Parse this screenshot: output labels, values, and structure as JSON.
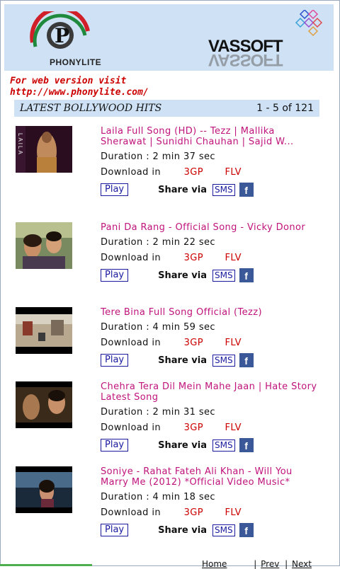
{
  "header": {
    "left_logo_text": "PHONYLITE",
    "right_logo_text": "VASSOFT"
  },
  "promo": {
    "line1": "For web version visit",
    "line2": "http://www.phonylite.com/"
  },
  "section": {
    "title": "LATEST BOLLYWOOD HITS",
    "range": "1 - 5 of 121"
  },
  "labels": {
    "download_in": "Download in",
    "format_3gp": "3GP",
    "format_flv": "FLV",
    "play": "Play",
    "share_via": "Share via",
    "sms": "SMS",
    "facebook_letter": "f"
  },
  "videos": [
    {
      "title": "Laila Full Song (HD) -- Tezz | Mallika Sherawat | Sunidhi Chauhan | Sajid W...",
      "duration": "Duration : 2 min 37 sec",
      "thumb_label": "LAILA"
    },
    {
      "title": "Pani Da Rang - Official Song - Vicky Donor",
      "duration": "Duration : 2 min 22 sec",
      "thumb_label": ""
    },
    {
      "title": "Tere Bina Full Song Official (Tezz)",
      "duration": "Duration : 4 min 59 sec",
      "thumb_label": ""
    },
    {
      "title": "Chehra Tera Dil Mein Mahe Jaan | Hate Story Latest Song",
      "duration": "Duration : 2 min 31 sec",
      "thumb_label": ""
    },
    {
      "title": "Soniye - Rahat Fateh Ali Khan - Will You Marry Me (2012) *Official Video Music*",
      "duration": "Duration : 4 min 18 sec",
      "thumb_label": ""
    }
  ],
  "footer": {
    "home": "Home",
    "prev": "Prev",
    "next": "Next",
    "sep": "|"
  },
  "colors": {
    "header_bg": "#cfe2f5",
    "title_pink": "#c0137b",
    "format_red": "#cc0000",
    "link_blue": "#1a1aa0",
    "facebook_blue": "#3b5998"
  }
}
